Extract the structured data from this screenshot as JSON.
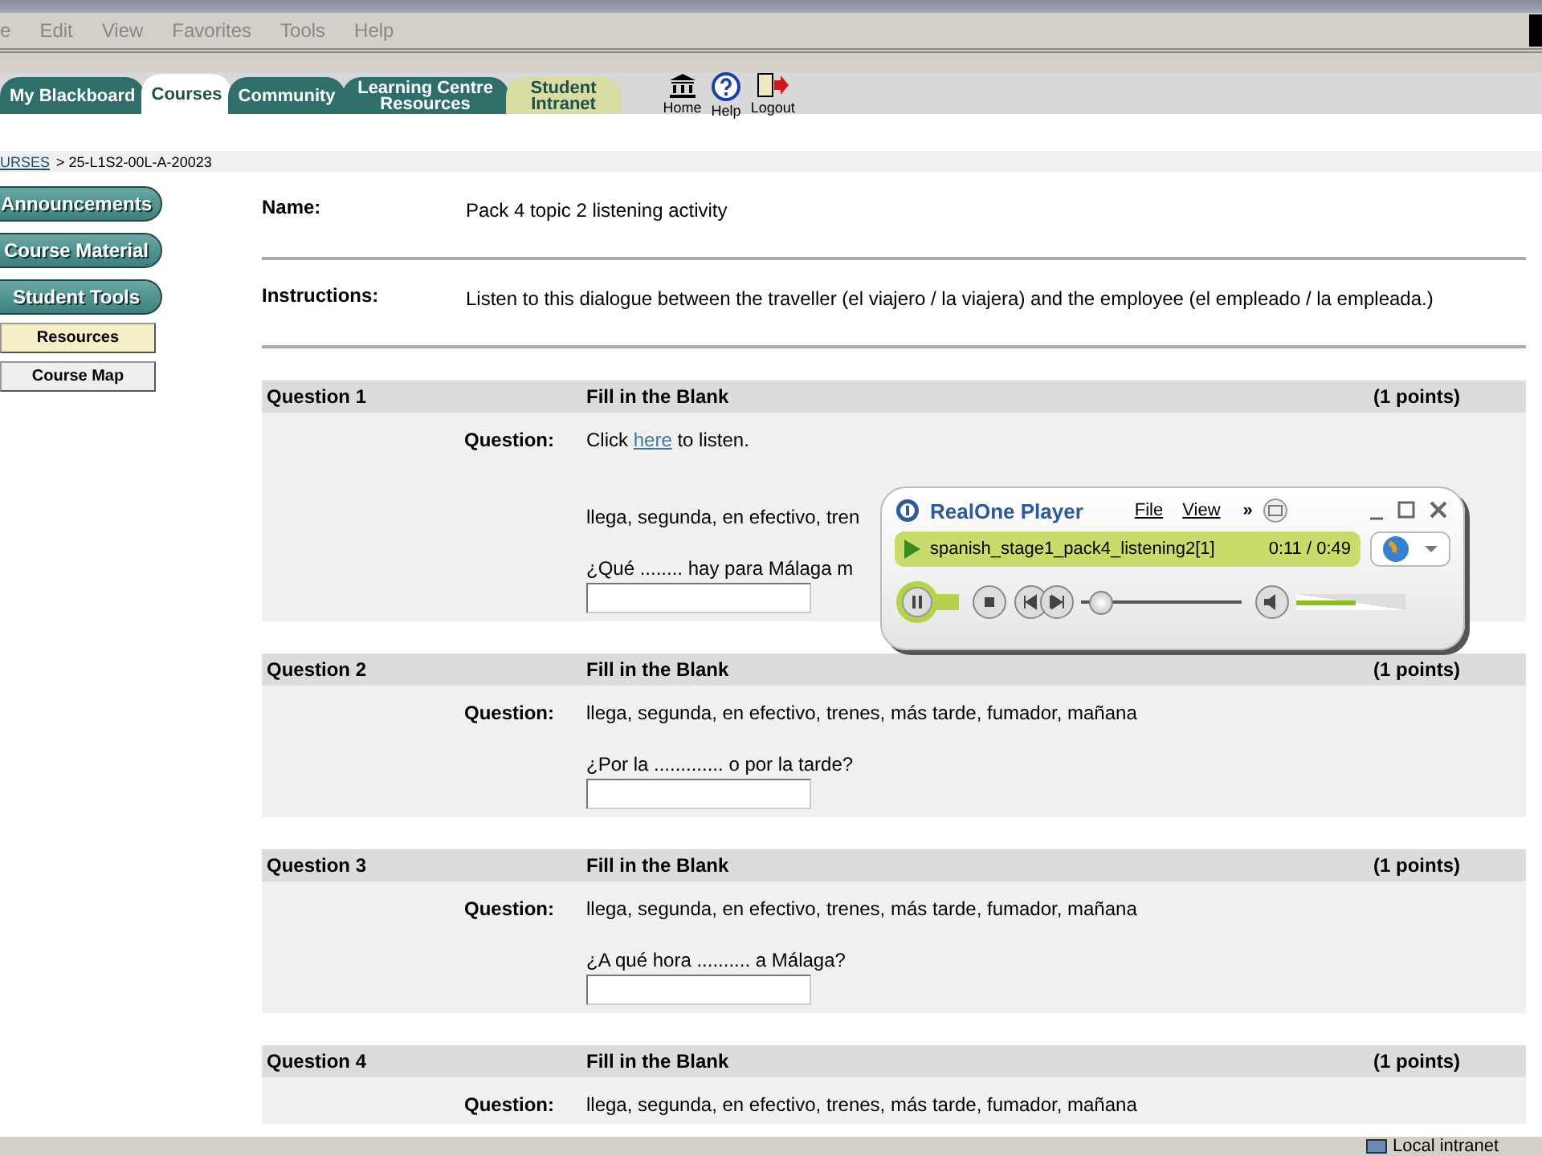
{
  "menu": [
    "e",
    "Edit",
    "View",
    "Favorites",
    "Tools",
    "Help"
  ],
  "tabs": [
    {
      "label": "My Blackboard",
      "selected": false,
      "kind": "main"
    },
    {
      "label": "Courses",
      "selected": true,
      "kind": "main"
    },
    {
      "label": "Community",
      "selected": false,
      "kind": "main"
    },
    {
      "label": "Learning Centre Resources",
      "selected": false,
      "kind": "main"
    },
    {
      "label": "Student Intranet",
      "selected": false,
      "kind": "extra"
    }
  ],
  "top_links": [
    {
      "label": "Home",
      "kind": "home"
    },
    {
      "label": "Help",
      "kind": "help"
    },
    {
      "label": "Logout",
      "kind": "logout"
    }
  ],
  "breadcrumb": {
    "link": "URSES",
    "current": "> 25-L1S2-00L-A-20023"
  },
  "sidebar": [
    {
      "label": "Announcements",
      "kind": "main",
      "selected": false
    },
    {
      "label": "Course Material",
      "kind": "main",
      "selected": false
    },
    {
      "label": "Student Tools",
      "kind": "main",
      "selected": false
    },
    {
      "label": "Resources",
      "kind": "sub",
      "selected": true
    },
    {
      "label": "Course Map",
      "kind": "sub",
      "selected": false
    }
  ],
  "info": [
    {
      "label": "Name:",
      "value": "Pack 4 topic 2 listening activity"
    },
    {
      "label": "Instructions:",
      "value": "Listen to this dialogue between the traveller (el viajero / la viajera) and the employee (el empleado / la empleada.)"
    }
  ],
  "questions": [
    {
      "title": "Question 1",
      "type": "Fill in the Blank",
      "points": "(1 points)",
      "label": "Question:",
      "intro": {
        "before": "Click",
        "link": "here",
        "after": "to listen."
      },
      "words": "llega, segunda, en efectivo, tren",
      "prompt": "¿Qué ........ hay para Málaga m",
      "answer_field": true
    },
    {
      "title": "Question 2",
      "type": "Fill in the Blank",
      "points": "(1 points)",
      "label": "Question:",
      "words": "llega, segunda, en efectivo, trenes, más tarde, fumador, mañana",
      "prompt": "¿Por la ............. o por la tarde?",
      "answer_field": true
    },
    {
      "title": "Question 3",
      "type": "Fill in the Blank",
      "points": "(1 points)",
      "label": "Question:",
      "words": "llega, segunda, en efectivo, trenes, más tarde, fumador, mañana",
      "prompt": "¿A qué hora .......... a Málaga?",
      "answer_field": true
    },
    {
      "title": "Question 4",
      "type": "Fill in the Blank",
      "points": "(1 points)",
      "label": "Question:",
      "words": "llega, segunda, en efectivo, trenes, más tarde, fumador, mañana",
      "answer_field": false
    }
  ],
  "player": {
    "brand": "RealOne Player",
    "menu": [
      "File",
      "View"
    ],
    "more": "»",
    "track": "spanish_stage1_pack4_listening2[1]",
    "time": "0:11 / 0:49",
    "seek": {
      "level": 0.12
    },
    "volume": {
      "level": 0.55
    }
  },
  "status_bar": {
    "zone": "Local intranet"
  }
}
